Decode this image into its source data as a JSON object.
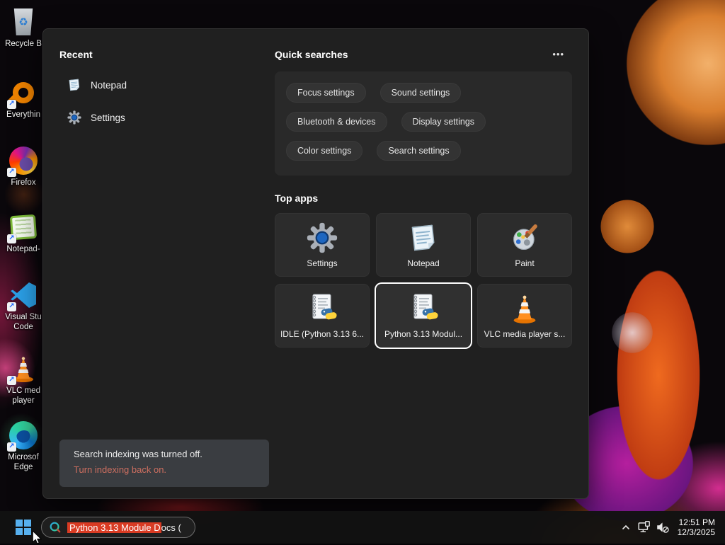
{
  "colors": {
    "selection_highlight": "#d93b23",
    "notice_link": "#ce6f60",
    "tile_selected_border": "#ffffff",
    "start_logo_blue": "#57b0ee",
    "panel_bg": "#202020",
    "taskbar_bg": "#121212"
  },
  "desktop_icons": [
    {
      "label": "Recycle B"
    },
    {
      "label": "Everythin"
    },
    {
      "label": "Firefox"
    },
    {
      "label": "Notepad-"
    },
    {
      "label": "Visual Stu",
      "label2": "Code"
    },
    {
      "label": "VLC med",
      "label2": "player"
    },
    {
      "label": "Microsof",
      "label2": "Edge"
    }
  ],
  "panel": {
    "recent": {
      "title": "Recent",
      "items": [
        {
          "label": "Notepad"
        },
        {
          "label": "Settings"
        }
      ]
    },
    "quick": {
      "title": "Quick searches",
      "more": "•••",
      "pills": [
        "Focus settings",
        "Sound settings",
        "Bluetooth & devices",
        "Display settings",
        "Color settings",
        "Search settings"
      ]
    },
    "top_apps": {
      "title": "Top apps",
      "tiles": [
        {
          "label": "Settings"
        },
        {
          "label": "Notepad"
        },
        {
          "label": "Paint"
        },
        {
          "label": "IDLE (Python 3.13 6..."
        },
        {
          "label": "Python 3.13 Modul...",
          "selected": true
        },
        {
          "label": "VLC media player s..."
        }
      ]
    },
    "notice": {
      "message": "Search indexing was turned off.",
      "action": "Turn indexing back on."
    }
  },
  "taskbar": {
    "search_selected_text": "Python 3.13 Module D",
    "search_rest_text": "ocs (",
    "time": "12:51 PM",
    "date": "12/3/2025"
  }
}
